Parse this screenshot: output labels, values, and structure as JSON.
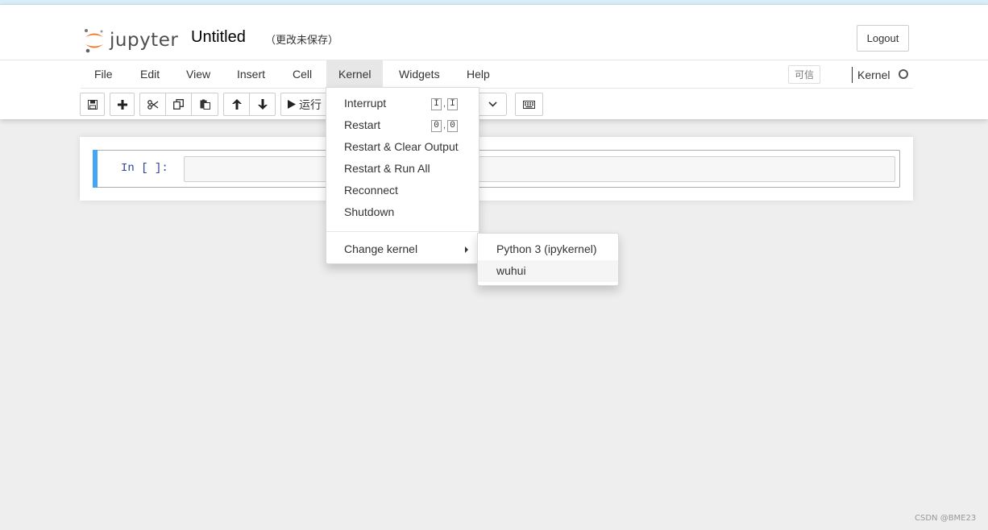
{
  "header": {
    "logo_text": "jupyter",
    "notebook_title": "Untitled",
    "save_status": "（更改未保存）",
    "logout_label": "Logout"
  },
  "menubar": {
    "items": [
      "File",
      "Edit",
      "View",
      "Insert",
      "Cell",
      "Kernel",
      "Widgets",
      "Help"
    ],
    "active": "Kernel",
    "trusted_label": "可信",
    "kernel_label": "Kernel"
  },
  "toolbar": {
    "run_label": "运行"
  },
  "cell": {
    "prompt": "In [ ]:",
    "content": ""
  },
  "kernel_menu": {
    "items": [
      {
        "label": "Interrupt",
        "keys": [
          "I",
          "I"
        ]
      },
      {
        "label": "Restart",
        "keys": [
          "0",
          "0"
        ]
      },
      {
        "label": "Restart & Clear Output"
      },
      {
        "label": "Restart & Run All"
      },
      {
        "label": "Reconnect"
      },
      {
        "label": "Shutdown"
      },
      {
        "label": "Change kernel"
      }
    ]
  },
  "change_kernel_submenu": {
    "items": [
      "Python 3 (ipykernel)",
      "wuhui"
    ],
    "hovered": "wuhui"
  },
  "watermark": "CSDN @BME23",
  "colors": {
    "cell_selected_bar": "#42a5f5",
    "prompt": "#303f9f",
    "logo_orange": "#f37726"
  }
}
